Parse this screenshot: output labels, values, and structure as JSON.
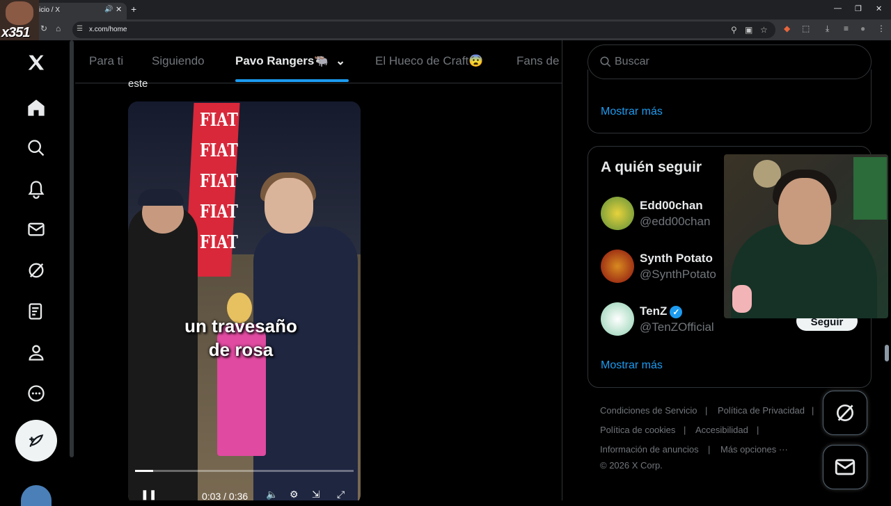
{
  "browser": {
    "tab_title": "icio / X",
    "url": "x.com/home"
  },
  "overlay": {
    "brand": "x351"
  },
  "nav": {
    "items": [
      "x-logo",
      "home",
      "search",
      "notifications",
      "messages",
      "grok",
      "lists",
      "profile",
      "more"
    ]
  },
  "feed_tabs": [
    "Para ti",
    "Siguiendo",
    "Pavo Rangers🐃",
    "El Hueco de Craft😨",
    "Fans de"
  ],
  "post": {
    "text_fragment": "este",
    "video_banner_text": "FIAT",
    "caption_line1": "un travesaño",
    "caption_line2": "de rosa",
    "time": "0:03 / 0:36",
    "progress": 0.083
  },
  "search": {
    "placeholder": "Buscar"
  },
  "trends": {
    "show_more": "Mostrar más"
  },
  "who_to_follow": {
    "title": "A quién seguir",
    "accounts": [
      {
        "name": "Edd00chan",
        "handle": "@edd00chan"
      },
      {
        "name": "Synth Potato",
        "handle": "@SynthPotato"
      },
      {
        "name": "TenZ",
        "handle": "@TenZOfficial",
        "verified": true
      }
    ],
    "follow_label": "Seguir",
    "show_more": "Mostrar más"
  },
  "footer": {
    "links": [
      "Condiciones de Servicio",
      "Política de Privacidad",
      "Política de cookies",
      "Accesibilidad",
      "Información de anuncios",
      "Más opciones ···"
    ],
    "copyright": "© 2026 X Corp."
  },
  "colors": {
    "accent": "#1d9bf0",
    "bg": "#000000",
    "text": "#e7e9ea",
    "muted": "#71767b"
  }
}
